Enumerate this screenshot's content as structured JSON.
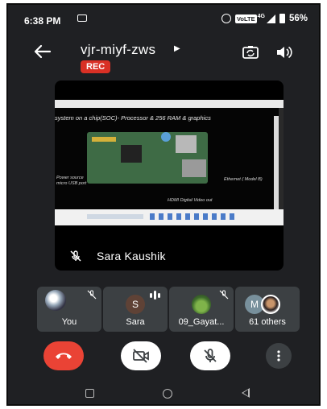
{
  "status_bar": {
    "time": "6:38 PM",
    "volte_badge": "VoLTE",
    "network": "4G",
    "battery": "56%",
    "icons": [
      "cast-icon",
      "alarm-icon",
      "signal-icon",
      "battery-icon"
    ]
  },
  "header": {
    "meeting_code": "vjr-miyf-zws",
    "recording_badge": "REC",
    "icons": [
      "back-arrow-icon",
      "chevron-right-icon",
      "switch-camera-icon",
      "speaker-icon"
    ]
  },
  "presentation": {
    "presenter_name": "Sara Kaushik",
    "presenter_mic": "muted",
    "slide_title": "system on a chip(SOC)- Processor & 256 RAM & graphics",
    "slide_labels": {
      "power": "Power source micro USB port",
      "ethernet": "Ethernet ( Model B)",
      "hdmi": "HDMI Digital Video out"
    }
  },
  "participants": [
    {
      "label": "You",
      "avatar": "photo",
      "mic": "muted"
    },
    {
      "label": "Sara",
      "avatar": "S",
      "mic": "speaking"
    },
    {
      "label": "09_Gayat...",
      "avatar": "photo",
      "mic": "muted"
    },
    {
      "label": "61 others",
      "avatar": "M",
      "mic": "none"
    }
  ],
  "controls": {
    "icons": [
      "end-call-icon",
      "camera-off-icon",
      "mic-off-icon",
      "more-vert-icon"
    ],
    "colors": {
      "end_call": "#ea4335",
      "toggle_bg": "#ffffff",
      "more_bg": "#3c4043"
    }
  },
  "theme": {
    "background": "#1f2023",
    "tile": "#3c4043",
    "rec": "#d93025"
  }
}
